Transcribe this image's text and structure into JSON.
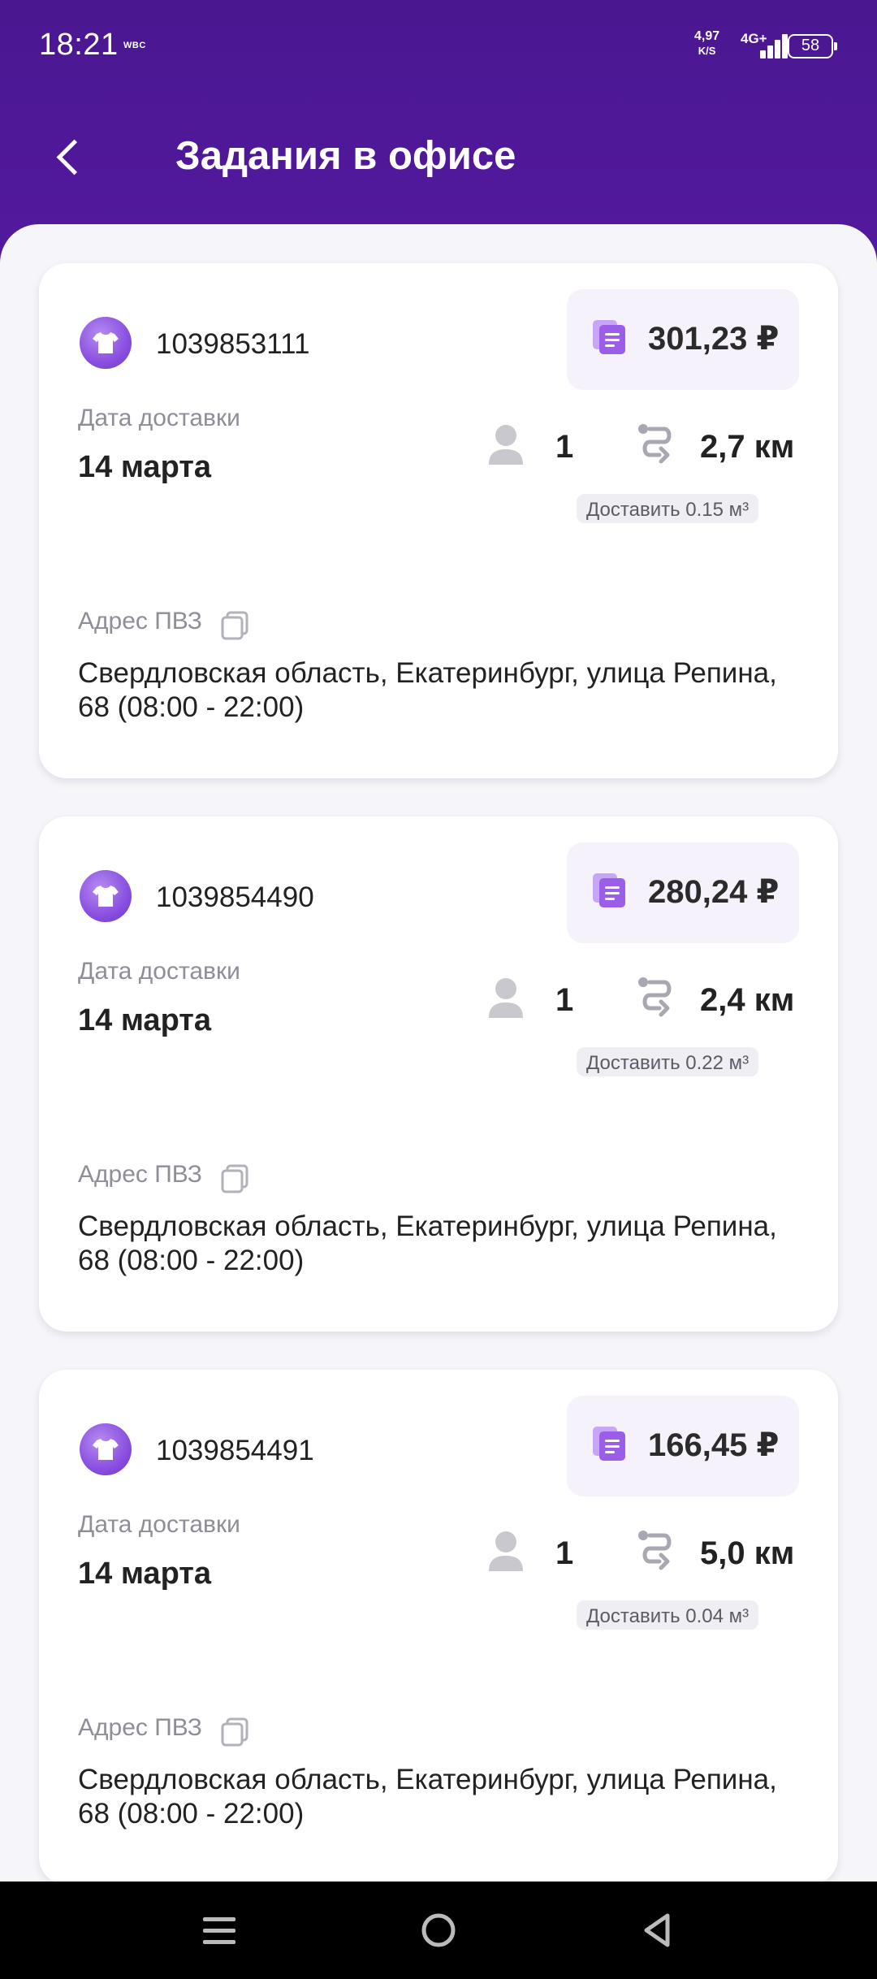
{
  "status_bar": {
    "time": "18:21",
    "carrier": "WBC",
    "speed_value": "4,97",
    "speed_unit": "K/S",
    "network": "4G+",
    "battery": "58"
  },
  "header": {
    "title": "Задания в офисе",
    "back_icon": "chevron-left-icon"
  },
  "labels": {
    "delivery_date": "Дата доставки",
    "pickup_address": "Адрес ПВЗ"
  },
  "orders": [
    {
      "id": "1039853111",
      "price": "301,23 ₽",
      "date": "14 марта",
      "count": "1",
      "distance": "2,7 км",
      "volume": "Доставить 0.15 м³",
      "address": "Свердловская область, Екатеринбург, улица Репина, 68 (08:00 - 22:00)"
    },
    {
      "id": "1039854490",
      "price": "280,24 ₽",
      "date": "14 марта",
      "count": "1",
      "distance": "2,4 км",
      "volume": "Доставить 0.22 м³",
      "address": "Свердловская область, Екатеринбург, улица Репина, 68 (08:00 - 22:00)"
    },
    {
      "id": "1039854491",
      "price": "166,45 ₽",
      "date": "14 марта",
      "count": "1",
      "distance": "5,0 км",
      "volume": "Доставить 0.04 м³",
      "address": "Свердловская область, Екатеринбург, улица Репина, 68 (08:00 - 22:00)"
    }
  ],
  "colors": {
    "brand_purple": "#4c1a99",
    "accent": "#8a4fe0",
    "background": "#f6f5f9"
  },
  "nav_icons": [
    "menu-icon",
    "home-icon",
    "back-icon"
  ]
}
